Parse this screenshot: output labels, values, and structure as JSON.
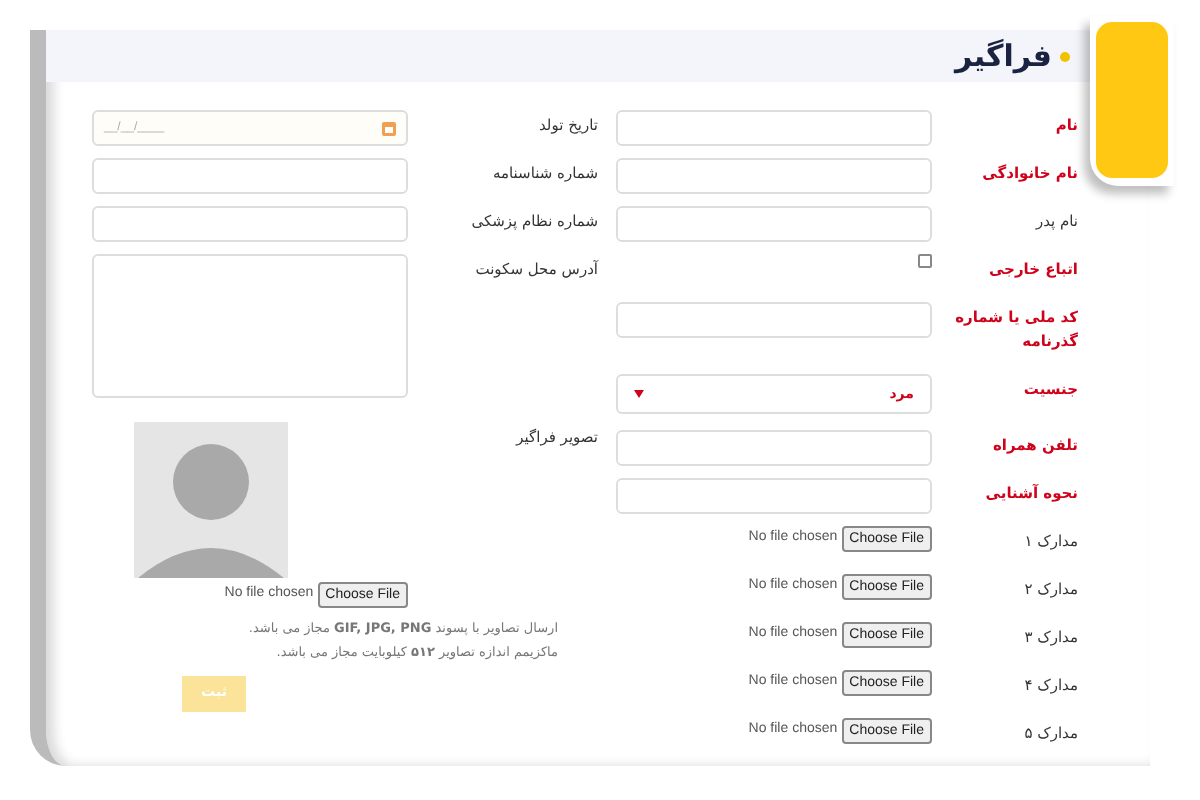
{
  "title": "فراگیر",
  "right_fields": [
    {
      "kind": "text",
      "label": "نام",
      "required": true
    },
    {
      "kind": "text",
      "label": "نام خانوادگی",
      "required": true
    },
    {
      "kind": "text",
      "label": "نام پدر",
      "required": false
    },
    {
      "kind": "checkbox",
      "label": "اتباع خارجی",
      "required": true,
      "checked": false
    },
    {
      "kind": "text",
      "label": "کد ملی یا شماره گذرنامه",
      "required": true
    },
    {
      "kind": "select",
      "label": "جنسیت",
      "required": true,
      "value": "مرد"
    },
    {
      "kind": "text",
      "label": "تلفن همراه",
      "required": true
    },
    {
      "kind": "text",
      "label": "نحوه آشنایی",
      "required": true
    },
    {
      "kind": "file",
      "label": "مدارک ۱",
      "required": false,
      "status": "No file chosen",
      "button": "Choose File"
    },
    {
      "kind": "file",
      "label": "مدارک ۲",
      "required": false,
      "status": "No file chosen",
      "button": "Choose File"
    },
    {
      "kind": "file",
      "label": "مدارک ۳",
      "required": false,
      "status": "No file chosen",
      "button": "Choose File"
    },
    {
      "kind": "file",
      "label": "مدارک ۴",
      "required": false,
      "status": "No file chosen",
      "button": "Choose File"
    },
    {
      "kind": "file",
      "label": "مدارک ۵",
      "required": false,
      "status": "No file chosen",
      "button": "Choose File"
    }
  ],
  "left_fields": [
    {
      "kind": "date",
      "label": "تاریخ تولد",
      "placeholder": "__/__/____"
    },
    {
      "kind": "text",
      "label": "شماره شناسنامه"
    },
    {
      "kind": "text",
      "label": "شماره نظام پزشکی"
    },
    {
      "kind": "textarea",
      "label": "آدرس محل سکونت"
    }
  ],
  "photo": {
    "label": "تصویر فراگیر",
    "status": "No file chosen",
    "button": "Choose File"
  },
  "notes": [
    "ارسال تصاویر با پسوند **GIF, JPG, PNG** مجاز می باشد.",
    "ماکزیمم اندازه تصاویر **۵۱۲** کیلوبایت مجاز می باشد."
  ],
  "submit": "ثبت"
}
